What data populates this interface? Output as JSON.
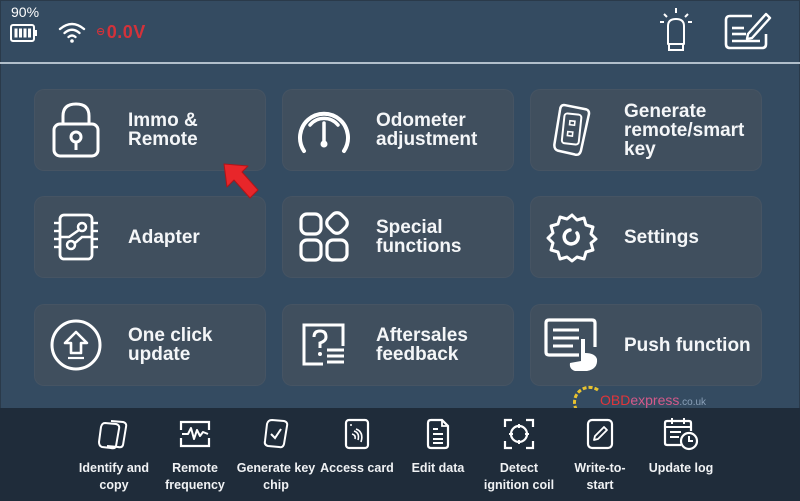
{
  "status_bar": {
    "battery_percent": "90%",
    "battery_level": 0.9,
    "voltage_prefix": "⊖",
    "voltage": "0.0V",
    "colors": {
      "voltage": "#d3323a"
    },
    "right_icons": [
      "vci-light-icon",
      "feedback-note-icon"
    ]
  },
  "main_menu": {
    "tiles": [
      {
        "label": "Immo & Remote",
        "icon": "lock-icon"
      },
      {
        "label": "Odometer adjustment",
        "icon": "gauge-icon"
      },
      {
        "label": "Generate remote/smart key",
        "icon": "smart-key-icon"
      },
      {
        "label": "Adapter",
        "icon": "adapter-chip-icon"
      },
      {
        "label": "Special functions",
        "icon": "special-functions-icon"
      },
      {
        "label": "Settings",
        "icon": "gear-icon"
      },
      {
        "label": "One click update",
        "icon": "upload-icon"
      },
      {
        "label": "Aftersales feedback",
        "icon": "question-list-icon"
      },
      {
        "label": "Push function",
        "icon": "push-touch-icon"
      }
    ]
  },
  "bottom_bar": {
    "items": [
      {
        "label_line1": "Identify and",
        "label_line2": "copy",
        "icon": "identify-copy-icon"
      },
      {
        "label_line1": "Remote",
        "label_line2": "frequency",
        "icon": "frequency-icon"
      },
      {
        "label_line1": "Generate key",
        "label_line2": "chip",
        "icon": "key-chip-icon"
      },
      {
        "label_line1": "Access card",
        "label_line2": "",
        "icon": "access-card-icon"
      },
      {
        "label_line1": "Edit data",
        "label_line2": "",
        "icon": "edit-data-icon"
      },
      {
        "label_line1": "Detect",
        "label_line2": "ignition coil",
        "icon": "ignition-coil-icon"
      },
      {
        "label_line1": "Write-to-",
        "label_line2": "start",
        "icon": "write-icon"
      },
      {
        "label_line1": "Update log",
        "label_line2": "",
        "icon": "update-log-icon"
      }
    ]
  },
  "watermark": {
    "brand": "OBD",
    "brand2": "express",
    "suffix": ".co.uk"
  },
  "colors": {
    "background": "#344b61",
    "tile": "#404f5e",
    "bottom_bar": "#1f2c3a",
    "pointer_arrow": "#e8262a"
  }
}
